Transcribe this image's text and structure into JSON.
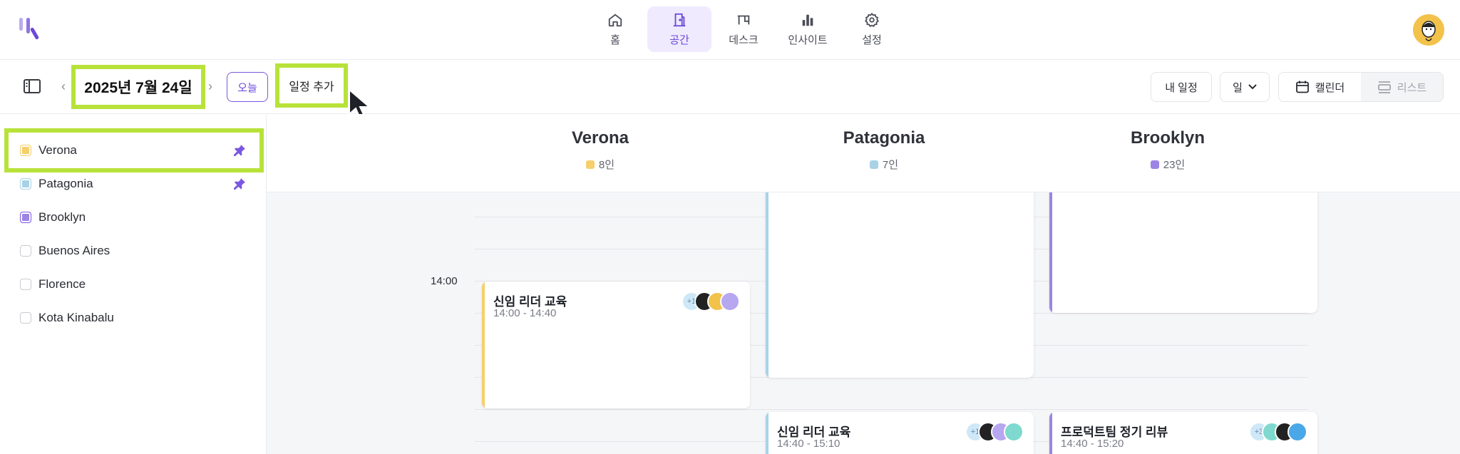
{
  "nav": {
    "items": [
      {
        "label": "홈",
        "icon": "home-icon",
        "active": false
      },
      {
        "label": "공간",
        "icon": "door-icon",
        "active": true
      },
      {
        "label": "데스크",
        "icon": "desk-icon",
        "active": false
      },
      {
        "label": "인사이트",
        "icon": "bar-chart-icon",
        "active": false
      },
      {
        "label": "설정",
        "icon": "gear-icon",
        "active": false
      }
    ]
  },
  "toolbar": {
    "date": "2025년 7월 24일",
    "today_label": "오늘",
    "add_label": "일정 추가",
    "my_schedule_label": "내 일정",
    "day_label": "일",
    "calendar_label": "캘린더",
    "list_label": "리스트"
  },
  "sidebar": {
    "spaces": [
      {
        "label": "Verona",
        "color": "#f6cf6c",
        "pinned": true
      },
      {
        "label": "Patagonia",
        "color": "#a9d2e6",
        "pinned": true
      },
      {
        "label": "Brooklyn",
        "color": "#9c84e6",
        "pinned": false
      },
      {
        "label": "Buenos Aires",
        "color": "",
        "pinned": false
      },
      {
        "label": "Florence",
        "color": "",
        "pinned": false
      },
      {
        "label": "Kota Kinabalu",
        "color": "",
        "pinned": false
      }
    ]
  },
  "columns": [
    {
      "name": "Verona",
      "count": "8인",
      "color": "#f6cf6c"
    },
    {
      "name": "Patagonia",
      "count": "7인",
      "color": "#a9d2e6"
    },
    {
      "name": "Brooklyn",
      "count": "23인",
      "color": "#9c84e6"
    }
  ],
  "time_label": "14:00",
  "events": [
    {
      "title": "신임 리더 교육",
      "time": "14:00 - 14:40",
      "plus": "+1"
    },
    {
      "title": "신임 리더 교육",
      "time": "14:40 - 15:10",
      "plus": "+1"
    },
    {
      "title": "프로덕트팀 정기 리뷰",
      "time": "14:40 - 15:20",
      "plus": "+3"
    }
  ],
  "colors": {
    "accent": "#6b48d8",
    "highlight": "#b8e23a"
  }
}
